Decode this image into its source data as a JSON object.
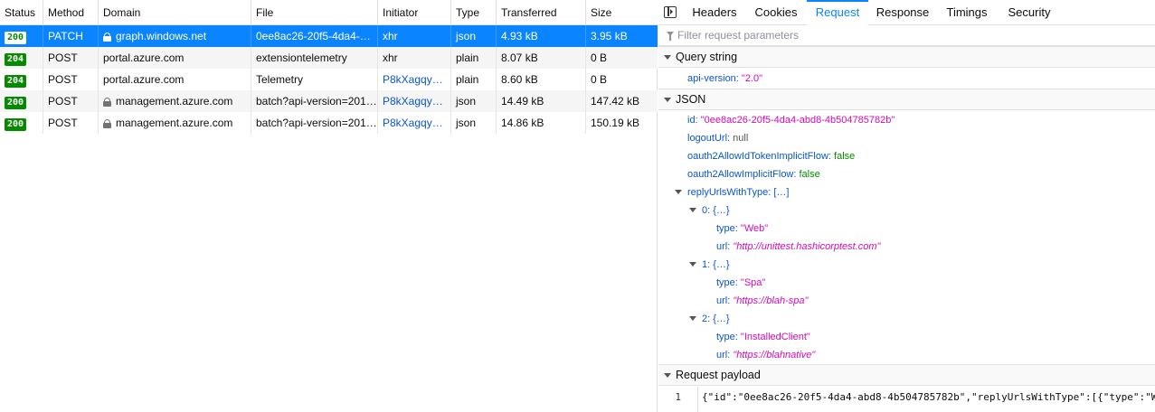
{
  "table": {
    "headers": [
      "Status",
      "Method",
      "Domain",
      "File",
      "Initiator",
      "Type",
      "Transferred",
      "Size"
    ],
    "rows": [
      {
        "status": "200",
        "method": "PATCH",
        "domain": "graph.windows.net",
        "secure": true,
        "file": "0ee8ac26-20f5-4da4-…",
        "initiator": "xhr",
        "type": "json",
        "transferred": "4.93 kB",
        "size": "3.95 kB"
      },
      {
        "status": "204",
        "method": "POST",
        "domain": "portal.azure.com",
        "secure": false,
        "file": "extensiontelemetry",
        "initiator": "xhr",
        "type": "plain",
        "transferred": "8.07 kB",
        "size": "0 B"
      },
      {
        "status": "204",
        "method": "POST",
        "domain": "portal.azure.com",
        "secure": false,
        "file": "Telemetry",
        "initiator": "P8kXagqyU…",
        "type": "plain",
        "transferred": "8.60 kB",
        "size": "0 B"
      },
      {
        "status": "200",
        "method": "POST",
        "domain": "management.azure.com",
        "secure": true,
        "file": "batch?api-version=201…",
        "initiator": "P8kXagqyU…",
        "type": "json",
        "transferred": "14.49 kB",
        "size": "147.42 kB"
      },
      {
        "status": "200",
        "method": "POST",
        "domain": "management.azure.com",
        "secure": true,
        "file": "batch?api-version=201…",
        "initiator": "P8kXagqyU…",
        "type": "json",
        "transferred": "14.86 kB",
        "size": "150.19 kB"
      }
    ]
  },
  "details": {
    "tabs": [
      "Headers",
      "Cookies",
      "Request",
      "Response",
      "Timings",
      "Security"
    ],
    "active_tab": "Request",
    "filter_placeholder": "Filter request parameters",
    "query_section": "Query string",
    "query": {
      "key": "api-version:",
      "value": "\"2.0\""
    },
    "json_section": "JSON",
    "json": {
      "id_key": "id:",
      "id_val": "\"0ee8ac26-20f5-4da4-abd8-4b504785782b\"",
      "logout_key": "logoutUrl:",
      "logout_val": "null",
      "implicit_token_key": "oauth2AllowIdTokenImplicitFlow:",
      "implicit_token_val": "false",
      "implicit_key": "oauth2AllowImplicitFlow:",
      "implicit_val": "false",
      "reply_key": "replyUrlsWithType:",
      "reply_val": "[…]",
      "items": [
        {
          "index": "0:",
          "collapsed": "{…}",
          "type_key": "type:",
          "type_val": "\"Web\"",
          "url_key": "url:",
          "url_val": "\"http://unittest.hashicorptest.com\""
        },
        {
          "index": "1:",
          "collapsed": "{…}",
          "type_key": "type:",
          "type_val": "\"Spa\"",
          "url_key": "url:",
          "url_val": "\"https://blah-spa\""
        },
        {
          "index": "2:",
          "collapsed": "{…}",
          "type_key": "type:",
          "type_val": "\"InstalledClient\"",
          "url_key": "url:",
          "url_val": "\"https://blahnative\""
        }
      ]
    },
    "payload_section": "Request payload",
    "payload_line_no": "1",
    "payload_code": "{\"id\":\"0ee8ac26-20f5-4da4-abd8-4b504785782b\",\"replyUrlsWithType\":[{\"type\":\"W"
  },
  "colors": {
    "accent": "#0a84ff",
    "status_ok": "#058b00",
    "json_key": "#0b55c6",
    "json_string": "#d00ab6",
    "json_bool": "#058b00"
  }
}
